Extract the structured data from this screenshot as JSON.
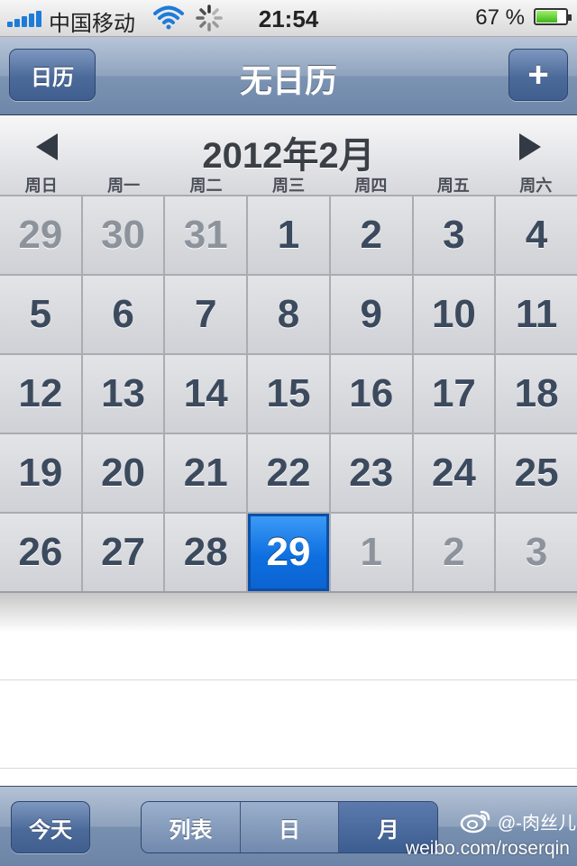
{
  "status_bar": {
    "carrier": "中国移动",
    "time": "21:54",
    "battery_percent": "67 %",
    "battery_level": 0.67,
    "signal_bars": 5
  },
  "nav": {
    "left_button": "日历",
    "title": "无日历",
    "right_button": "+"
  },
  "month": {
    "title": "2012年2月",
    "weekdays": [
      "周日",
      "周一",
      "周二",
      "周三",
      "周四",
      "周五",
      "周六"
    ]
  },
  "calendar": {
    "days": [
      {
        "label": "29",
        "state": "other"
      },
      {
        "label": "30",
        "state": "other"
      },
      {
        "label": "31",
        "state": "other"
      },
      {
        "label": "1",
        "state": "current"
      },
      {
        "label": "2",
        "state": "current"
      },
      {
        "label": "3",
        "state": "current"
      },
      {
        "label": "4",
        "state": "current"
      },
      {
        "label": "5",
        "state": "current"
      },
      {
        "label": "6",
        "state": "current"
      },
      {
        "label": "7",
        "state": "current"
      },
      {
        "label": "8",
        "state": "current"
      },
      {
        "label": "9",
        "state": "current"
      },
      {
        "label": "10",
        "state": "current"
      },
      {
        "label": "11",
        "state": "current"
      },
      {
        "label": "12",
        "state": "current"
      },
      {
        "label": "13",
        "state": "current"
      },
      {
        "label": "14",
        "state": "current"
      },
      {
        "label": "15",
        "state": "current"
      },
      {
        "label": "16",
        "state": "current"
      },
      {
        "label": "17",
        "state": "current"
      },
      {
        "label": "18",
        "state": "current"
      },
      {
        "label": "19",
        "state": "current"
      },
      {
        "label": "20",
        "state": "current"
      },
      {
        "label": "21",
        "state": "current"
      },
      {
        "label": "22",
        "state": "current"
      },
      {
        "label": "23",
        "state": "current"
      },
      {
        "label": "24",
        "state": "current"
      },
      {
        "label": "25",
        "state": "current"
      },
      {
        "label": "26",
        "state": "current"
      },
      {
        "label": "27",
        "state": "current"
      },
      {
        "label": "28",
        "state": "current"
      },
      {
        "label": "29",
        "state": "today"
      },
      {
        "label": "1",
        "state": "other"
      },
      {
        "label": "2",
        "state": "other"
      },
      {
        "label": "3",
        "state": "other"
      }
    ]
  },
  "toolbar": {
    "today": "今天",
    "segments": [
      "列表",
      "日",
      "月"
    ],
    "active_segment": "月"
  },
  "watermark": {
    "handle": "@-肉丝儿",
    "url": "weibo.com/roserqin"
  },
  "colors": {
    "today_highlight": "#0e6fe0",
    "nav_bar": "#7c93b2",
    "wifi_icon": "#1f7bd8"
  }
}
